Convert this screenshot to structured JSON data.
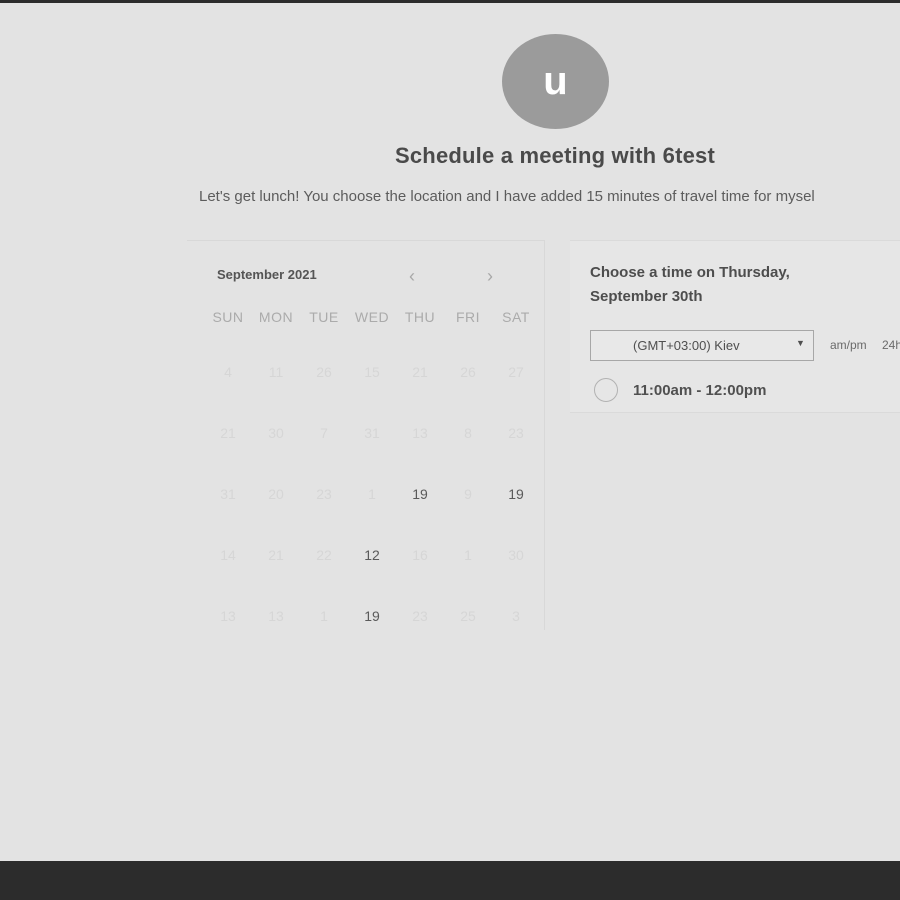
{
  "avatar": {
    "initial": "u"
  },
  "title": "Schedule a meeting with 6test",
  "description": "Let's get lunch! You choose the location and I have added 15 minutes of travel time for mysel",
  "calendar": {
    "month_label": "September 2021",
    "prev_icon": "chevron-left-icon",
    "next_icon": "chevron-right-icon",
    "weekdays": [
      "SUN",
      "MON",
      "TUE",
      "WED",
      "THU",
      "FRI",
      "SAT"
    ],
    "weeks": [
      [
        {
          "d": "4"
        },
        {
          "d": "11"
        },
        {
          "d": "26"
        },
        {
          "d": "15"
        },
        {
          "d": "21"
        },
        {
          "d": "26"
        },
        {
          "d": "27"
        }
      ],
      [
        {
          "d": "21"
        },
        {
          "d": "30"
        },
        {
          "d": "7"
        },
        {
          "d": "31"
        },
        {
          "d": "13"
        },
        {
          "d": "8"
        },
        {
          "d": "23"
        }
      ],
      [
        {
          "d": "31"
        },
        {
          "d": "20"
        },
        {
          "d": "23"
        },
        {
          "d": "1"
        },
        {
          "d": "19",
          "active": true
        },
        {
          "d": "9"
        },
        {
          "d": "19",
          "active": true
        }
      ],
      [
        {
          "d": "14"
        },
        {
          "d": "21"
        },
        {
          "d": "22"
        },
        {
          "d": "12",
          "active": true
        },
        {
          "d": "16"
        },
        {
          "d": "1"
        },
        {
          "d": "30"
        }
      ],
      [
        {
          "d": "13"
        },
        {
          "d": "13"
        },
        {
          "d": "1"
        },
        {
          "d": "19",
          "active": true
        },
        {
          "d": "23"
        },
        {
          "d": "25"
        },
        {
          "d": "3"
        }
      ]
    ]
  },
  "time_panel": {
    "heading": "Choose a time on Thursday, September 30th",
    "timezone": {
      "value": "(GMT+03:00) Kiev",
      "caret_icon": "caret-down-icon"
    },
    "format_ampm": "am/pm",
    "format_24h": "24h",
    "slots": [
      {
        "label": "11:00am - 12:00pm"
      }
    ]
  }
}
